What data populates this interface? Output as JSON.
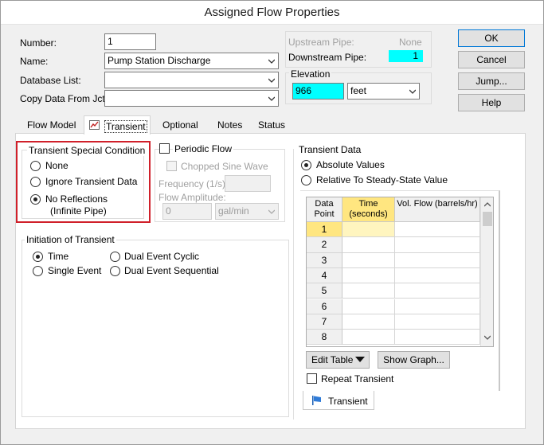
{
  "window": {
    "title": "Assigned Flow Properties"
  },
  "fields": {
    "number_label": "Number:",
    "number_value": "1",
    "name_label": "Name:",
    "name_value": "Pump Station Discharge",
    "database_label": "Database List:",
    "database_value": "",
    "copy_label": "Copy Data From Jct...",
    "copy_value": ""
  },
  "pipes": {
    "upstream_label": "Upstream Pipe:",
    "upstream_value": "None",
    "downstream_label": "Downstream Pipe:",
    "downstream_value": "1"
  },
  "elevation": {
    "label": "Elevation",
    "value": "966",
    "unit": "feet"
  },
  "buttons": {
    "ok": "OK",
    "cancel": "Cancel",
    "jump": "Jump...",
    "help": "Help"
  },
  "tabs": [
    {
      "label": "Flow Model"
    },
    {
      "label": "Transient"
    },
    {
      "label": "Optional"
    },
    {
      "label": "Notes"
    },
    {
      "label": "Status"
    }
  ],
  "transient_special": {
    "title": "Transient Special Condition",
    "options": [
      "None",
      "Ignore Transient Data",
      "No Reflections"
    ],
    "no_reflections_sub": "(Infinite Pipe)",
    "selected": "No Reflections"
  },
  "periodic": {
    "label": "Periodic Flow",
    "chopped_label": "Chopped Sine Wave",
    "frequency_label": "Frequency (1/s):",
    "amplitude_label": "Flow Amplitude:",
    "amplitude_value": "0",
    "amplitude_unit": "gal/min"
  },
  "initiation": {
    "title": "Initiation of Transient",
    "options": [
      "Time",
      "Single Event",
      "Dual Event Cyclic",
      "Dual Event Sequential"
    ],
    "selected": "Time"
  },
  "transient_data": {
    "title": "Transient Data",
    "absolute_label": "Absolute Values",
    "relative_label": "Relative To Steady-State Value",
    "selected": "Absolute Values",
    "columns": [
      "Data Point",
      "Time (seconds)",
      "Vol. Flow (barrels/hr)"
    ],
    "rows": [
      "1",
      "2",
      "3",
      "4",
      "5",
      "6",
      "7",
      "8"
    ],
    "edit_table_label": "Edit Table",
    "show_graph_label": "Show Graph...",
    "repeat_label": "Repeat Transient",
    "bottom_tab_label": "Transient"
  },
  "colors": {
    "highlight_field": "#00ffff",
    "red_box": "#d0202a",
    "selected_header": "#ffe680"
  },
  "icons": {
    "transient_tab_icon": "chart-icon",
    "bottom_tab_icon": "flag-icon"
  }
}
